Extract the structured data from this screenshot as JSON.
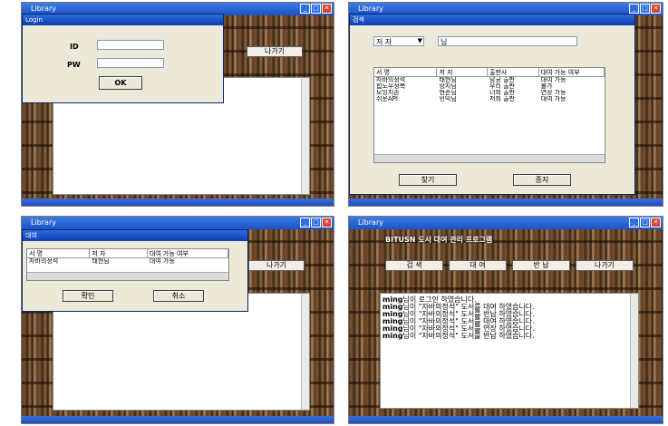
{
  "login": {
    "window_title": "Library",
    "dialog_title": "Login",
    "id_label": "ID",
    "pw_label": "PW",
    "id_value": "",
    "pw_value": "",
    "ok_label": "OK",
    "exit_label": "나가기"
  },
  "search": {
    "window_title": "Library",
    "dialog_title": "검색",
    "filter_selected": "저 자",
    "query": "님",
    "columns": [
      "서 명",
      "저 자",
      "출판사",
      "대여 가능 여부"
    ],
    "rows": [
      [
        "자바의정석",
        "태현님",
        "남궁 출판",
        "대여 가능"
      ],
      [
        "힙도우정복",
        "망치님",
        "우리 출판",
        "불가"
      ],
      [
        "모잉지존",
        "현준님",
        "너희 출판",
        "연장 가능"
      ],
      [
        "쉬운API",
        "민익님",
        "저희 출판",
        "대여 가능"
      ]
    ],
    "find_label": "찾기",
    "cancel_label": "종지"
  },
  "rent": {
    "window_title": "Library",
    "dialog_title": "대여",
    "columns": [
      "서 명",
      "저 자",
      "대여 가능 여부"
    ],
    "rows": [
      [
        "자바의정석",
        "태현님",
        "대여 가능"
      ]
    ],
    "confirm_label": "확인",
    "cancel_label": "취소",
    "exit_label": "나가기"
  },
  "main": {
    "window_title": "Library",
    "app_title": "BITUSN 도서 대여 관리 프로그램",
    "buttons": [
      "검 색",
      "대 여",
      "반 납",
      "나가기"
    ],
    "log": [
      {
        "user": "ming",
        "text": "님이 로그인 하였습니다."
      },
      {
        "user": "ming",
        "text": "님이 \"자바의정석\" 도서를 대여 하였습니다."
      },
      {
        "user": "ming",
        "text": "님이 \"자바의정석\" 도서를 반납 하였습니다."
      },
      {
        "user": "ming",
        "text": "님이 \"자바의정석\" 도서를 대여 하였습니다."
      },
      {
        "user": "ming",
        "text": "님이 \"자바의정석\" 도서를 연장 하였습니다."
      },
      {
        "user": "ming",
        "text": "님이 \"자바의정석\" 도서를 반납 하였습니다."
      }
    ]
  }
}
